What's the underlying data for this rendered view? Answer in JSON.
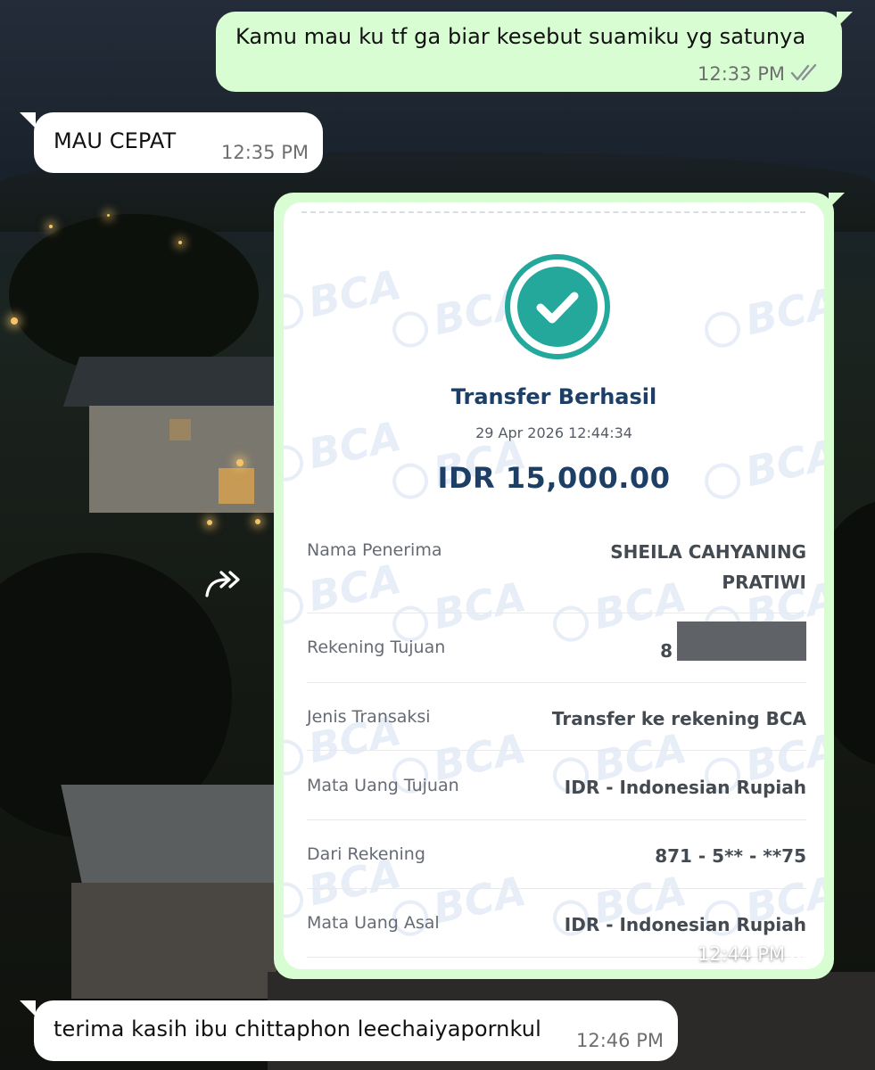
{
  "chat": {
    "messages": [
      {
        "direction": "outgoing",
        "text": "Kamu mau ku tf ga biar kesebut suamiku yg satunya",
        "time": "12:33 PM",
        "status": "read-ticks-icon"
      },
      {
        "direction": "incoming",
        "text": "MAU CEPAT",
        "time": "12:35 PM"
      },
      {
        "direction": "outgoing",
        "type": "image",
        "time": "12:44 PM",
        "status": "read-ticks-icon"
      },
      {
        "direction": "incoming",
        "text": "terima kasih ibu chittaphon leechaiyapornkul",
        "time": "12:46 PM"
      }
    ]
  },
  "receipt": {
    "watermark": "BCA",
    "status_icon": "check-circle-icon",
    "title": "Transfer Berhasil",
    "datetime": "29 Apr 2026 12:44:34",
    "amount": "IDR 15,000.00",
    "rows": [
      {
        "label": "Nama Penerima",
        "value_line1": "SHEILA CAHYANING",
        "value_line2": "PRATIWI"
      },
      {
        "label": "Rekening Tujuan",
        "value_visible": "8",
        "value_redacted": true
      },
      {
        "label": "Jenis Transaksi",
        "value": "Transfer ke rekening BCA"
      },
      {
        "label": "Mata Uang Tujuan",
        "value": "IDR - Indonesian Rupiah"
      },
      {
        "label": "Dari Rekening",
        "value": "871 - 5** - **75"
      },
      {
        "label": "Mata Uang Asal",
        "value": "IDR - Indonesian Rupiah"
      }
    ]
  },
  "colors": {
    "outgoing_bubble": "#d9fdd3",
    "incoming_bubble": "#ffffff",
    "check_teal": "#24a89c",
    "bca_navy": "#1d3f66"
  }
}
